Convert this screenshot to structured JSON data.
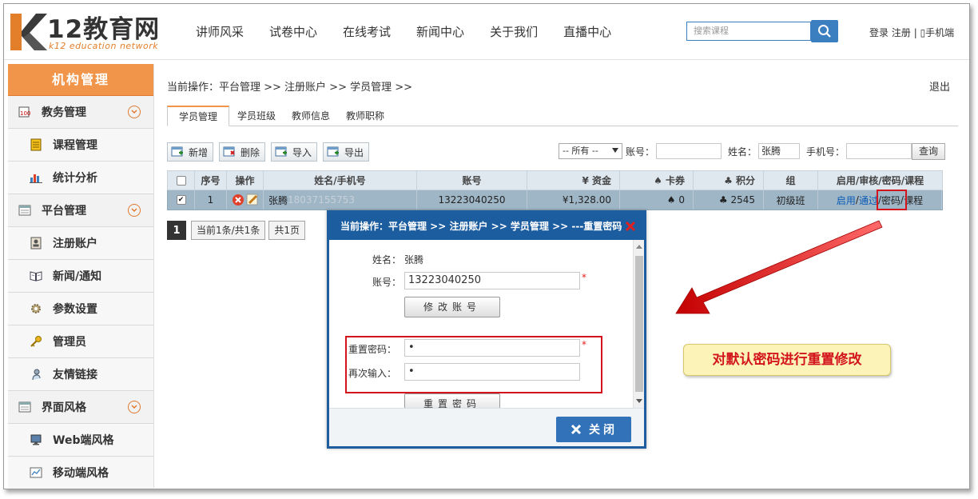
{
  "header": {
    "logo_title": "12教育网",
    "logo_sub": "k12 education network",
    "nav": [
      "讲师风采",
      "试卷中心",
      "在线考试",
      "新闻中心",
      "关于我们",
      "直播中心"
    ],
    "search_placeholder": "搜索课程",
    "login": "登录",
    "register": "注册",
    "separator": "|",
    "mobile": "手机端",
    "colors": {
      "accent": "#f0954a",
      "nav_blue": "#3c7fc1"
    }
  },
  "sidebar": {
    "title": "机构管理",
    "groups": [
      {
        "label": "教务管理",
        "icon": "book-icon",
        "items": [
          {
            "label": "课程管理",
            "icon": "course-icon"
          },
          {
            "label": "统计分析",
            "icon": "bar-chart-icon"
          }
        ]
      },
      {
        "label": "平台管理",
        "icon": "window-icon",
        "items": [
          {
            "label": "注册账户",
            "icon": "user-card-icon"
          },
          {
            "label": "新闻/通知",
            "icon": "open-book-icon"
          },
          {
            "label": "参数设置",
            "icon": "gear-icon"
          },
          {
            "label": "管理员",
            "icon": "key-icon"
          },
          {
            "label": "友情链接",
            "icon": "link-icon"
          }
        ]
      },
      {
        "label": "界面风格",
        "icon": "window-icon",
        "items": [
          {
            "label": "Web端风格",
            "icon": "monitor-icon"
          },
          {
            "label": "移动端风格",
            "icon": "chart-frame-icon"
          }
        ]
      }
    ]
  },
  "main": {
    "breadcrumb": "当前操作：平台管理 >> 注册账户 >> 学员管理 >>",
    "logout": "退出",
    "tabs": [
      "学员管理",
      "学员班级",
      "教师信息",
      "教师职称"
    ],
    "toolbar": [
      "新增",
      "删除",
      "导入",
      "导出"
    ],
    "filter": {
      "select_value": "-- 所有 --",
      "account_label": "账号：",
      "account_value": "",
      "name_label": "姓名：",
      "name_value": "张腾",
      "phone_label": "手机号：",
      "phone_value": "",
      "query": "查询"
    },
    "table": {
      "headers": [
        "序号",
        "操作",
        "姓名/手机号",
        "账号",
        "¥ 资金",
        "♠ 卡券",
        "♣ 积分",
        "组",
        "启用/审核/密码/课程"
      ],
      "row": {
        "index": "1",
        "name": "张腾",
        "phone": "18037155753",
        "account": "13223040250",
        "funds": "¥1,328.00",
        "coupon": "♠ 0",
        "points": "♣ 2545",
        "group": "初级班",
        "enable": "启用",
        "audit": "通过",
        "password": "密码",
        "course": "课程",
        "slash": "/"
      }
    },
    "pager": {
      "current": "1",
      "info": "当前1条/共1条",
      "total_pages": "共1页"
    }
  },
  "modal": {
    "title": "当前操作：平台管理 >> 注册账户 >> 学员管理 >> ---重置密码",
    "name_label": "姓名：",
    "name_value": "张腾",
    "account_label": "账号：",
    "account_value": "13223040250",
    "modify_account": "修改账号",
    "reset_label": "重置密码：",
    "reset_value": "•",
    "repeat_label": "再次输入：",
    "repeat_value": "•",
    "reset_button": "重置密码",
    "star": "*",
    "close": "关闭"
  },
  "annotation": {
    "text": "对默认密码进行重置修改",
    "color": "#d3141c"
  }
}
